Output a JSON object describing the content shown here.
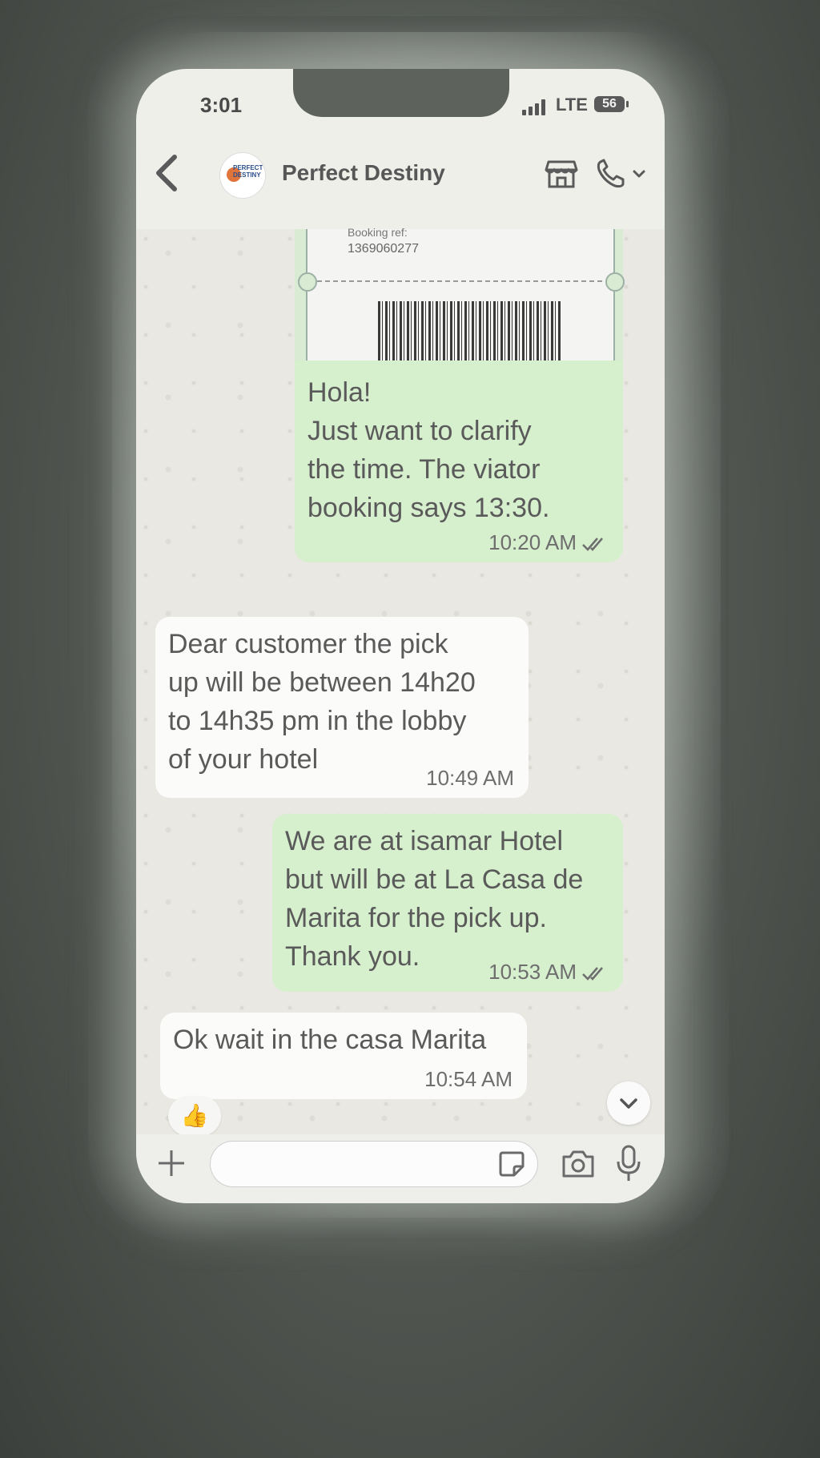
{
  "status_bar": {
    "time": "3:01",
    "network": "LTE",
    "battery": "56"
  },
  "header": {
    "back_icon": "chevron-left-icon",
    "avatar_text": "PERFECT DESTINY",
    "contact_name": "Perfect Destiny",
    "store_icon": "storefront-icon",
    "call_icon": "phone-icon"
  },
  "ticket": {
    "label": "Booking ref:",
    "ref": "1369060277"
  },
  "messages": [
    {
      "direction": "outgoing",
      "text": "Hola!\nJust want to clarify\nthe time. The viator\nbooking says 13:30.",
      "time": "10:20 AM",
      "read": true
    },
    {
      "direction": "incoming",
      "text": "Dear customer the pick\nup will be between 14h20\nto 14h35 pm in the lobby\nof your hotel",
      "time": "10:49 AM"
    },
    {
      "direction": "outgoing",
      "text": "We are at isamar Hotel\nbut will be at La Casa de\nMarita for the pick up.\nThank you.",
      "time": "10:53 AM",
      "read": true
    },
    {
      "direction": "incoming",
      "text": "Ok wait in the casa Marita",
      "time": "10:54 AM",
      "reaction": "👍"
    }
  ],
  "input_bar": {
    "placeholder": "",
    "plus_icon": "plus-icon",
    "sticker_icon": "sticker-icon",
    "camera_icon": "camera-icon",
    "mic_icon": "microphone-icon"
  },
  "colors": {
    "outgoing_bubble": "#d6efcd",
    "incoming_bubble": "#fbfbfa",
    "chat_background": "#e9e8e2"
  }
}
